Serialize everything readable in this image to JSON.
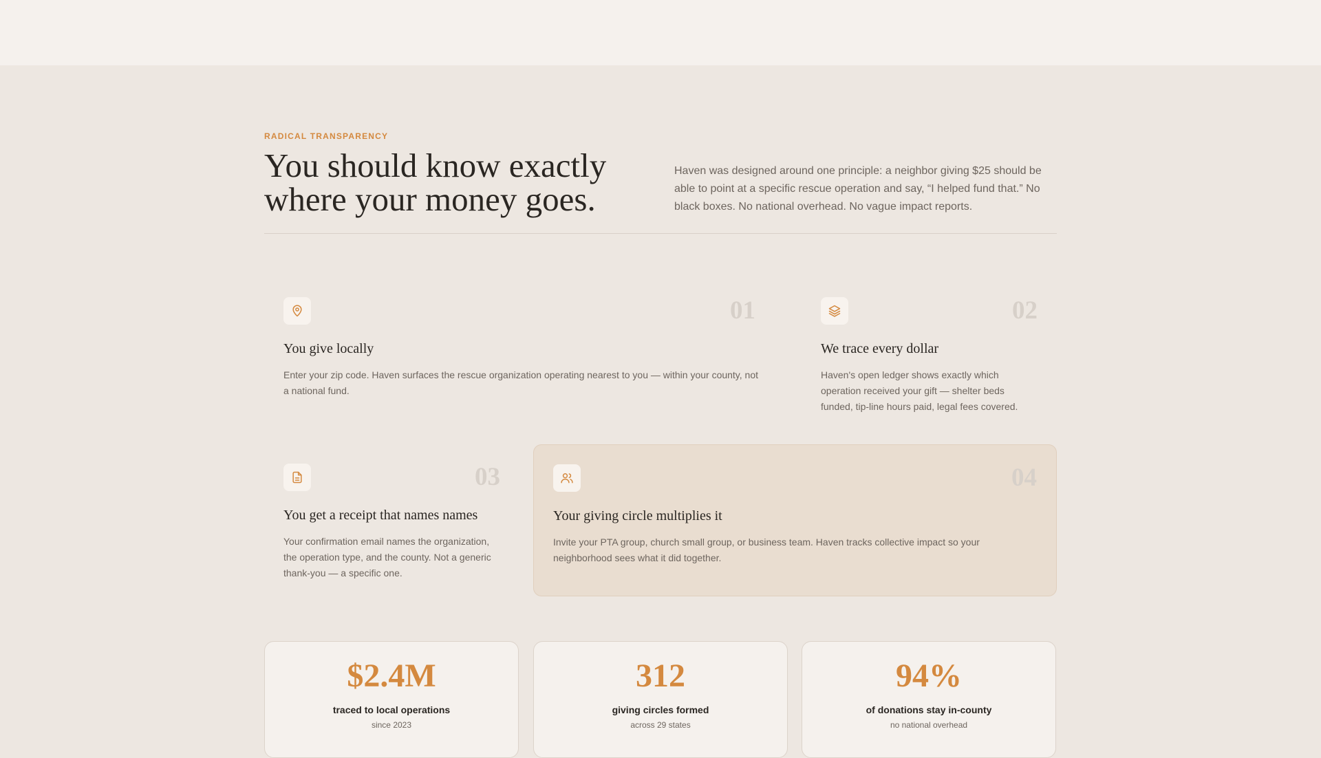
{
  "hero": {
    "eyebrow": "RADICAL TRANSPARENCY",
    "headline_line1": "You should know exactly",
    "headline_line2": "where your money goes.",
    "intro": "Haven was designed around one principle: a neighbor giving $25 should be able to point at a specific rescue operation and say, “I helped fund that.” No black boxes. No national overhead. No vague impact reports."
  },
  "steps": [
    {
      "number": "01",
      "icon": "map-pin-icon",
      "title": "You give locally",
      "body": "Enter your zip code. Haven surfaces the rescue organization operating nearest to you — within your county, not a national fund."
    },
    {
      "number": "02",
      "icon": "layers-icon",
      "title": "We trace every dollar",
      "body": "Haven's open ledger shows exactly which operation received your gift — shelter beds funded, tip-line hours paid, legal fees covered."
    },
    {
      "number": "03",
      "icon": "document-icon",
      "title": "You get a receipt that names names",
      "body": "Your confirmation email names the organization, the operation type, and the county. Not a generic thank-you — a specific one."
    },
    {
      "number": "04",
      "icon": "users-icon",
      "title": "Your giving circle multiplies it",
      "body": "Invite your PTA group, church small group, or business team. Haven tracks collective impact so your neighborhood sees what it did together."
    }
  ],
  "stats": [
    {
      "value": "$2.4M",
      "label": "traced to local operations",
      "sub": "since 2023"
    },
    {
      "value": "312",
      "label": "giving circles formed",
      "sub": "across 29 states"
    },
    {
      "value": "94%",
      "label": "of donations stay in-county",
      "sub": "no national overhead"
    }
  ],
  "colors": {
    "accent": "#d4893f",
    "background": "#ede7e1",
    "highlight_card": "#e9ddd0"
  }
}
